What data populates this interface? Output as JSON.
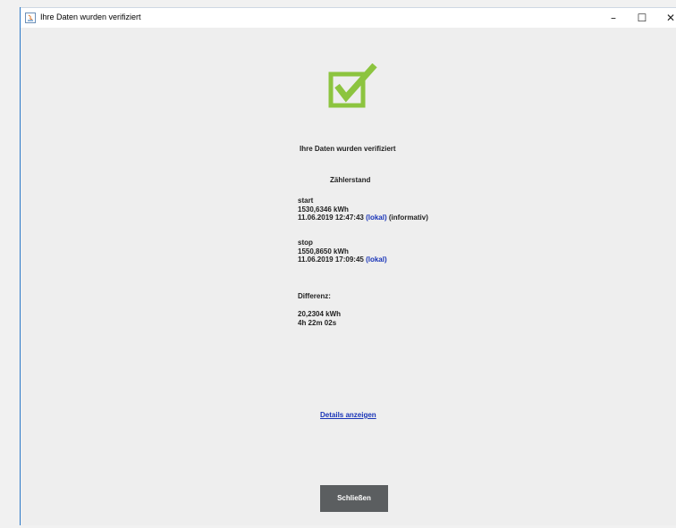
{
  "window": {
    "title": "Ihre Daten wurden verifiziert",
    "controls": {
      "minimize": "–",
      "maximize": "☐",
      "close": "✕"
    }
  },
  "main": {
    "heading": "Ihre Daten wurden verifiziert",
    "subheading": "Zählerstand",
    "start": {
      "label": "start",
      "value": "1530,6346 kWh",
      "timestamp": "11.06.2019 12:47:43",
      "local_tag": "(lokal)",
      "note": "(informativ)"
    },
    "stop": {
      "label": "stop",
      "value": "1550,8650 kWh",
      "timestamp": "11.06.2019 17:09:45",
      "local_tag": "(lokal)"
    },
    "difference": {
      "label": "Differenz:",
      "energy": "20,2304 kWh",
      "duration": "4h 22m 02s"
    },
    "details_link": "Details anzeigen",
    "close_button": "Schließen"
  },
  "colors": {
    "check_green": "#8cc43f",
    "link_blue": "#1a35b8",
    "button_bg": "#5b5e60",
    "window_border": "#2b78c7"
  },
  "icons": {
    "app": "java-app-icon",
    "status": "checkbox-checked-icon"
  }
}
